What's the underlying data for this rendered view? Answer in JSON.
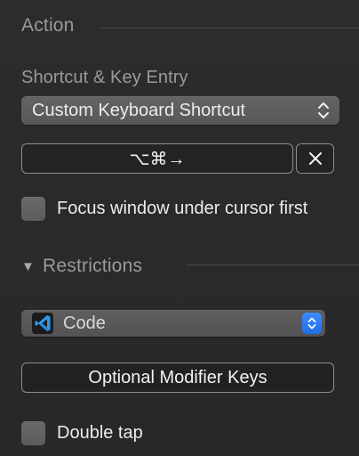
{
  "action": {
    "header": "Action",
    "shortcut_label": "Shortcut & Key Entry",
    "mode_select": {
      "selected": "Custom Keyboard Shortcut"
    },
    "shortcut_value": "⌥⌘→",
    "focus_checkbox": {
      "label": "Focus window under cursor first",
      "checked": false
    }
  },
  "restrictions": {
    "disclosure_glyph": "▼",
    "header": "Restrictions",
    "app_select": {
      "selected": "Code"
    },
    "optional_modifiers_button": "Optional Modifier Keys",
    "double_tap_checkbox": {
      "label": "Double tap",
      "checked": false
    }
  },
  "colors": {
    "accent": "#2f7df6",
    "vscode_blue": "#2e9bed"
  }
}
